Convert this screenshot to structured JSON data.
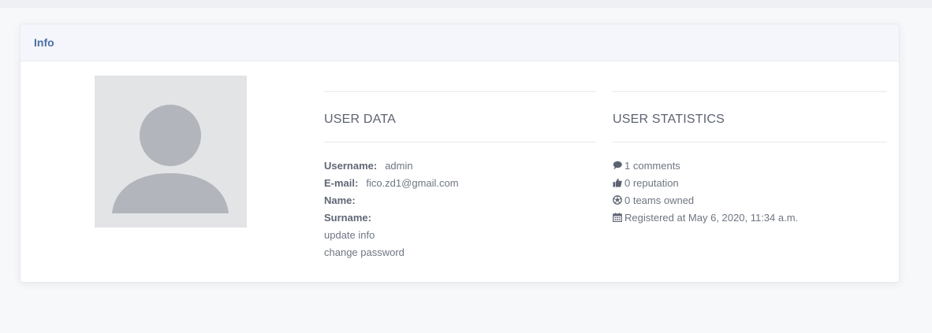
{
  "card": {
    "title": "Info"
  },
  "user_data": {
    "heading": "USER DATA",
    "username_label": "Username:",
    "username_value": "admin",
    "email_label": "E-mail:",
    "email_value": "fico.zd1@gmail.com",
    "name_label": "Name:",
    "name_value": "",
    "surname_label": "Surname:",
    "surname_value": "",
    "update_link": "update info",
    "password_link": "change password"
  },
  "user_stats": {
    "heading": "USER STATISTICS",
    "comments": "1 comments",
    "reputation": "0 reputation",
    "teams": "0 teams owned",
    "registered": "Registered at May 6, 2020, 11:34 a.m."
  },
  "icons": {
    "comments": "comment-icon",
    "reputation": "thumbs-up-icon",
    "teams": "soccer-ball-icon",
    "registered": "calendar-icon"
  },
  "colors": {
    "accent": "#4a6fa5",
    "avatar_bg": "#e3e4e6",
    "avatar_fg": "#b2b5bb"
  }
}
